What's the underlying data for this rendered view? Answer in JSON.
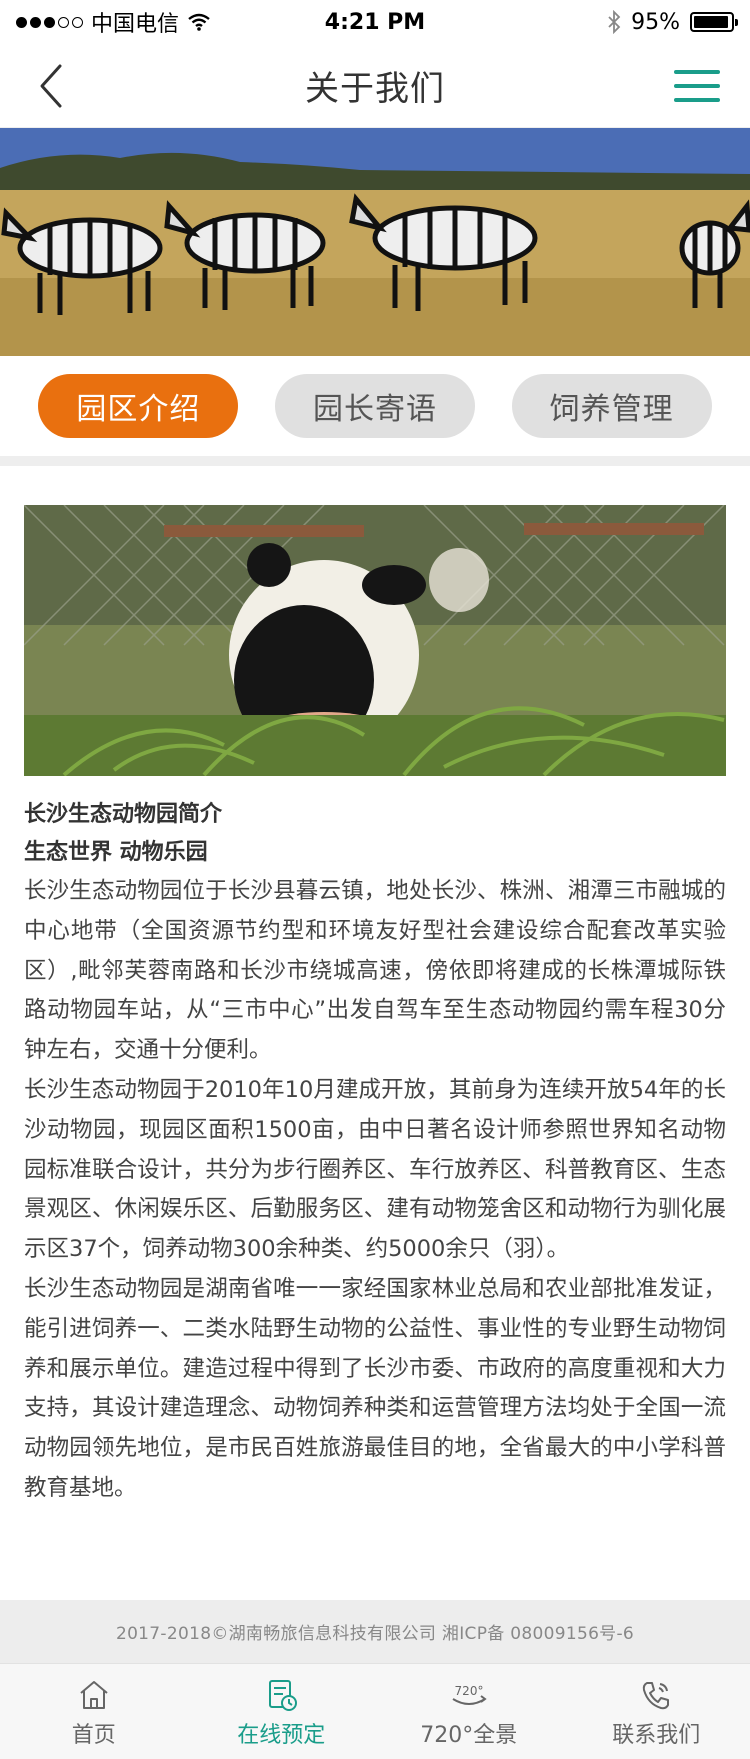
{
  "status_bar": {
    "carrier": "中国电信",
    "time": "4:21 PM",
    "battery": "95%",
    "battery_level": 0.95
  },
  "nav": {
    "title": "关于我们"
  },
  "tabs": [
    {
      "label": "园区介绍",
      "active": true
    },
    {
      "label": "园长寄语",
      "active": false
    },
    {
      "label": "饲养管理",
      "active": false
    }
  ],
  "content": {
    "title": "长沙生态动物园简介",
    "subtitle": "生态世界 动物乐园",
    "paragraphs": [
      "长沙生态动物园位于长沙县暮云镇，地处长沙、株洲、湘潭三市融城的中心地带（全国资源节约型和环境友好型社会建设综合配套改革实验区）,毗邻芙蓉南路和长沙市绕城高速，傍依即将建成的长株潭城际铁路动物园车站，从“三市中心”出发自驾车至生态动物园约需车程30分钟左右，交通十分便利。",
      "长沙生态动物园于2010年10月建成开放，其前身为连续开放54年的长沙动物园，现园区面积1500亩，由中日著名设计师参照世界知名动物园标准联合设计，共分为步行圈养区、车行放养区、科普教育区、生态景观区、休闲娱乐区、后勤服务区、建有动物笼舍区和动物行为驯化展示区37个，饲养动物300余种类、约5000余只（羽）。",
      "长沙生态动物园是湖南省唯一一家经国家林业总局和农业部批准发证，能引进饲养一、二类水陆野生动物的公益性、事业性的专业野生动物饲养和展示单位。建造过程中得到了长沙市委、市政府的高度重视和大力支持，其设计建造理念、动物饲养种类和运营管理方法均处于全国一流动物园领先地位，是市民百姓旅游最佳目的地，全省最大的中小学科普教育基地。"
    ]
  },
  "footer": {
    "copyright": "2017-2018©湖南畅旅信息科技有限公司  湘ICP备 08009156号-6"
  },
  "tabbar": [
    {
      "label": "首页",
      "icon": "home-icon",
      "active": false
    },
    {
      "label": "在线预定",
      "icon": "booking-icon",
      "active": true
    },
    {
      "label": "720°全景",
      "icon": "panorama-720-icon",
      "active": false
    },
    {
      "label": "联系我们",
      "icon": "phone-icon",
      "active": false
    }
  ],
  "colors": {
    "accent": "#e9700f",
    "brand": "#1a9d8a"
  }
}
